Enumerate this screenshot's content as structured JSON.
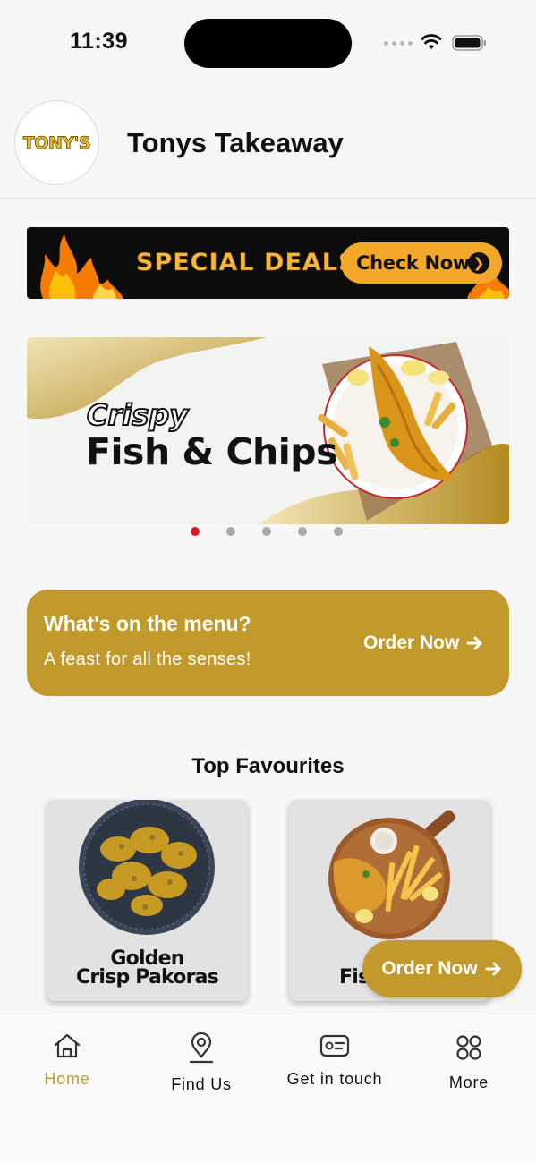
{
  "status_bar": {
    "time": "11:39"
  },
  "header": {
    "logo_text": "TONY'S",
    "title": "Tonys Takeaway"
  },
  "deals_banner": {
    "text": "SPECIAL DEALS",
    "button_label": "Check Now"
  },
  "hero_slider": {
    "slide_subtitle": "Crispy",
    "slide_title": "Fish & Chips",
    "slide_count": 5,
    "active_index": 0
  },
  "menu_card": {
    "title": "What's on the menu?",
    "subtitle": "A feast for all the senses!",
    "action_label": "Order Now"
  },
  "favourites": {
    "heading": "Top Favourites",
    "items": [
      {
        "name_line1": "Golden",
        "name_line2": "Crisp Pakoras"
      },
      {
        "name_line1": "Fis"
      }
    ]
  },
  "floating_button": {
    "label": "Order Now"
  },
  "tab_bar": {
    "items": [
      {
        "label": "Home",
        "icon": "home-icon",
        "active": true
      },
      {
        "label": "Find Us",
        "icon": "location-pin-icon",
        "active": false
      },
      {
        "label": "Get in touch",
        "icon": "contact-card-icon",
        "active": false
      },
      {
        "label": "More",
        "icon": "grid-icon",
        "active": false
      }
    ]
  },
  "colors": {
    "accent": "#c19a2b",
    "active_dot": "#e2171f",
    "deals_orange": "#f3a82a"
  }
}
